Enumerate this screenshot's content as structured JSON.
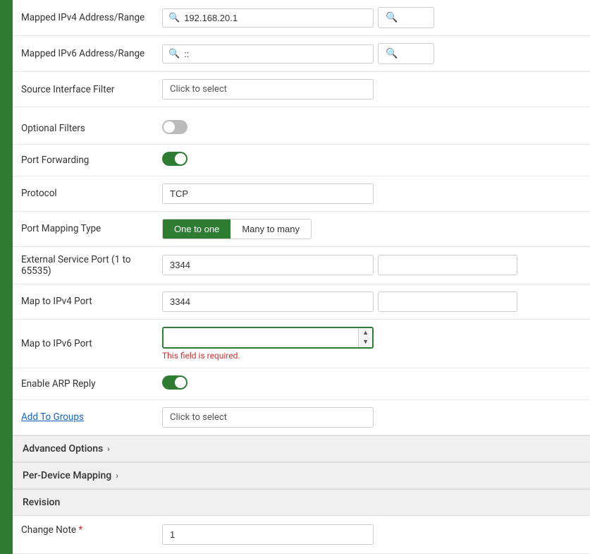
{
  "form": {
    "fields": {
      "mapped_ipv4_label": "Mapped IPv4 Address/Range",
      "mapped_ipv4_value": "192.168.20.1",
      "mapped_ipv6_label": "Mapped IPv6 Address/Range",
      "mapped_ipv6_value": "::",
      "source_interface_label": "Source Interface Filter",
      "source_interface_placeholder": "Click to select",
      "optional_filters_label": "Optional Filters",
      "optional_filters_on": false,
      "port_forwarding_label": "Port Forwarding",
      "port_forwarding_on": true,
      "protocol_label": "Protocol",
      "protocol_value": "TCP",
      "port_mapping_type_label": "Port Mapping Type",
      "port_mapping_options": [
        "One to one",
        "Many to many"
      ],
      "port_mapping_active": "One to one",
      "external_service_port_label": "External Service Port (1 to 65535)",
      "external_service_port_value": "3344",
      "map_to_ipv4_label": "Map to IPv4 Port",
      "map_to_ipv4_value": "3344",
      "map_to_ipv6_label": "Map to IPv6 Port",
      "map_to_ipv6_value": "",
      "ipv6_error": "This field is required.",
      "enable_arp_label": "Enable ARP Reply",
      "enable_arp_on": true,
      "add_to_groups_label": "Add To Groups",
      "add_to_groups_placeholder": "Click to select"
    },
    "sections": {
      "advanced_options": "Advanced Options",
      "per_device_mapping": "Per-Device Mapping",
      "revision": "Revision",
      "change_note_label": "Change Note",
      "change_note_required": true,
      "change_note_value": "1"
    }
  },
  "icons": {
    "search": "🔍",
    "chevron_right": "›",
    "spin_up": "▲",
    "spin_down": "▼"
  }
}
